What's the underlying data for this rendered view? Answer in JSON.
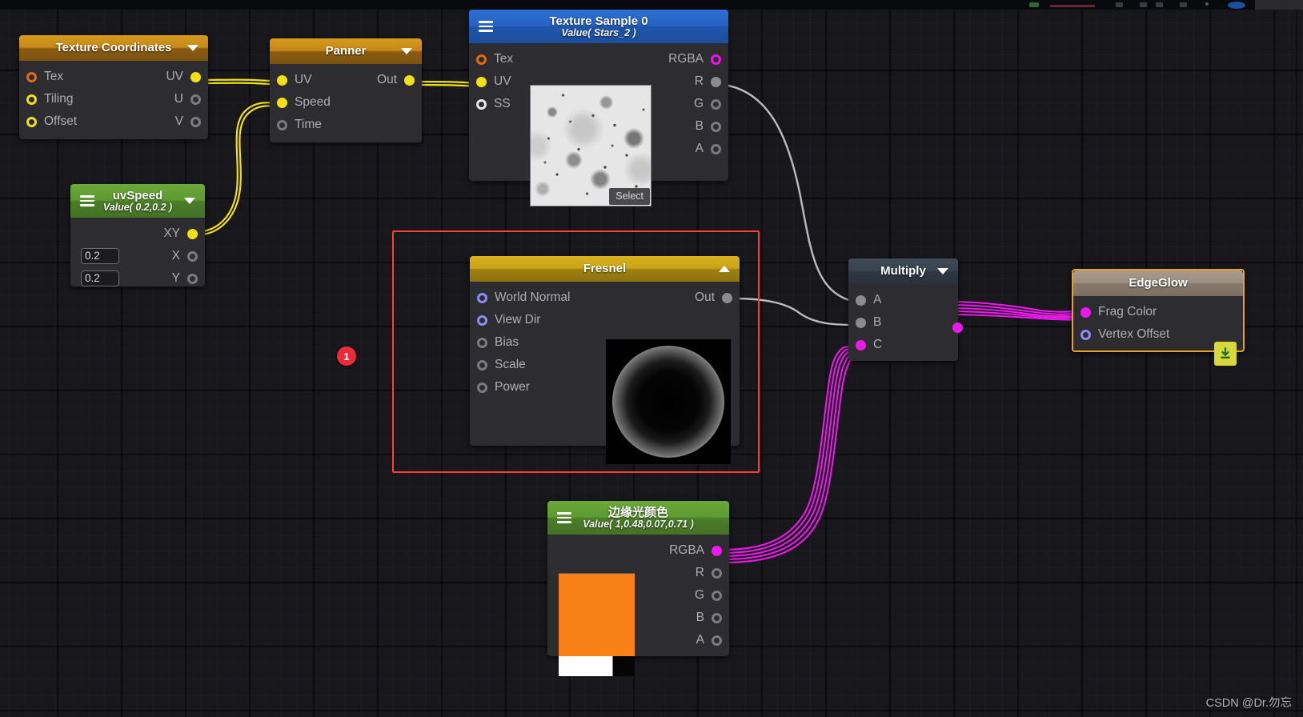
{
  "app": {
    "watermark": "CSDN @Dr.勿忘",
    "badge_label": "1",
    "accent_colors": {
      "header_orange": "#c48618",
      "header_yellow": "#c8a318",
      "header_blue": "#2663c2",
      "header_green": "#5d9a32",
      "header_slate": "#39434f",
      "header_tan": "#9c8e80",
      "wire_yellow": "#f2e017",
      "wire_gray": "#bcbcc0",
      "wire_magenta": "#ea1bea",
      "selection_red": "#ff3b3b",
      "badge_red": "#ec2b38",
      "swatch_orange": "#f97f17",
      "edgeglow_border": "#e8a020"
    }
  },
  "nodes": {
    "texture_coordinates": {
      "title": "Texture Coordinates",
      "inputs": [
        {
          "label": "Tex",
          "port": "orange-ring"
        },
        {
          "label": "Tiling",
          "port": "yellow-ring"
        },
        {
          "label": "Offset",
          "port": "yellow-ring"
        }
      ],
      "outputs": [
        {
          "label": "UV",
          "port": "yellow-fill"
        },
        {
          "label": "U",
          "port": "gray-ring"
        },
        {
          "label": "V",
          "port": "gray-ring"
        }
      ]
    },
    "panner": {
      "title": "Panner",
      "inputs": [
        {
          "label": "UV",
          "port": "yellow-fill"
        },
        {
          "label": "Speed",
          "port": "yellow-fill"
        },
        {
          "label": "Time",
          "port": "gray-ring"
        }
      ],
      "outputs": [
        {
          "label": "Out",
          "port": "yellow-fill"
        }
      ]
    },
    "texture_sample": {
      "title": "Texture Sample 0",
      "subtitle": "Value( Stars_2 )",
      "select_label": "Select",
      "inputs": [
        {
          "label": "Tex",
          "port": "orange-ring"
        },
        {
          "label": "UV",
          "port": "yellow-fill"
        },
        {
          "label": "SS",
          "port": "white-ring"
        }
      ],
      "outputs": [
        {
          "label": "RGBA",
          "port": "magenta-ring"
        },
        {
          "label": "R",
          "port": "gray-fill"
        },
        {
          "label": "G",
          "port": "gray-ring"
        },
        {
          "label": "B",
          "port": "gray-ring"
        },
        {
          "label": "A",
          "port": "gray-ring"
        }
      ]
    },
    "uv_speed": {
      "title": "uvSpeed",
      "subtitle": "Value( 0.2,0.2 )",
      "fields": [
        {
          "name": "x-value",
          "value": "0.2"
        },
        {
          "name": "y-value",
          "value": "0.2"
        }
      ],
      "outputs": [
        {
          "label": "XY",
          "port": "yellow-fill"
        },
        {
          "label": "X",
          "port": "gray-ring"
        },
        {
          "label": "Y",
          "port": "gray-ring"
        }
      ]
    },
    "fresnel": {
      "title": "Fresnel",
      "inputs": [
        {
          "label": "World Normal",
          "port": "blue-ring"
        },
        {
          "label": "View Dir",
          "port": "blue-ring"
        },
        {
          "label": "Bias",
          "port": "gray-ring"
        },
        {
          "label": "Scale",
          "port": "gray-ring"
        },
        {
          "label": "Power",
          "port": "gray-ring"
        }
      ],
      "outputs": [
        {
          "label": "Out",
          "port": "gray-fill"
        }
      ]
    },
    "multiply": {
      "title": "Multiply",
      "inputs": [
        {
          "label": "A",
          "port": "gray-fill"
        },
        {
          "label": "B",
          "port": "gray-fill"
        },
        {
          "label": "C",
          "port": "magenta-fill"
        }
      ],
      "outputs": [
        {
          "label": "",
          "port": "magenta-fill"
        }
      ]
    },
    "edge_glow": {
      "title": "EdgeGlow",
      "inputs": [
        {
          "label": "Frag Color",
          "port": "magenta-fill"
        },
        {
          "label": "Vertex Offset",
          "port": "blue-ring"
        }
      ],
      "icon": "save-download-icon"
    },
    "rim_color": {
      "title": "边缘光颜色",
      "subtitle": "Value( 1,0.48,0.07,0.71 )",
      "swatch_color": "#f97f17",
      "alpha": 0.71,
      "outputs": [
        {
          "label": "RGBA",
          "port": "magenta-fill"
        },
        {
          "label": "R",
          "port": "gray-ring"
        },
        {
          "label": "G",
          "port": "gray-ring"
        },
        {
          "label": "B",
          "port": "gray-ring"
        },
        {
          "label": "A",
          "port": "gray-ring"
        }
      ]
    }
  }
}
